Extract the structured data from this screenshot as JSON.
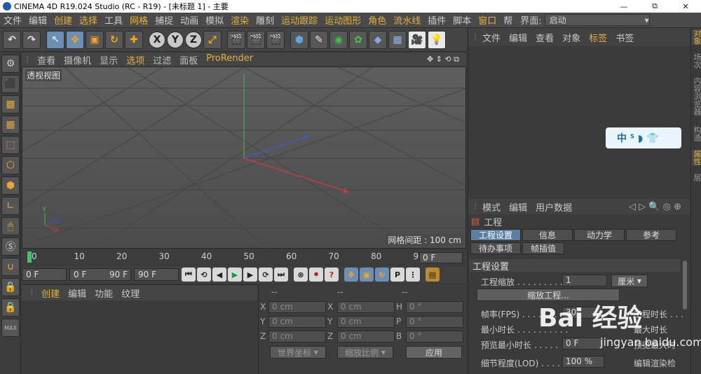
{
  "window": {
    "title": "CINEMA 4D R19.024 Studio (RC - R19) - [未标题 1] - 主要",
    "controls": [
      "—",
      "⧉",
      "✕"
    ]
  },
  "menu": {
    "items": [
      {
        "label": "文件",
        "accent": false
      },
      {
        "label": "编辑",
        "accent": false
      },
      {
        "label": "创建",
        "accent": true
      },
      {
        "label": "选择",
        "accent": true
      },
      {
        "label": "工具",
        "accent": false
      },
      {
        "label": "网格",
        "accent": true
      },
      {
        "label": "捕捉",
        "accent": false
      },
      {
        "label": "动画",
        "accent": false
      },
      {
        "label": "模拟",
        "accent": false
      },
      {
        "label": "渲染",
        "accent": true
      },
      {
        "label": "雕刻",
        "accent": false
      },
      {
        "label": "运动跟踪",
        "accent": true
      },
      {
        "label": "运动图形",
        "accent": true
      },
      {
        "label": "角色",
        "accent": true
      },
      {
        "label": "流水线",
        "accent": true
      },
      {
        "label": "插件",
        "accent": false
      },
      {
        "label": "脚本",
        "accent": false
      },
      {
        "label": "窗口",
        "accent": true
      },
      {
        "label": "帮",
        "accent": false
      }
    ],
    "layout_label": "界面:",
    "layout_value": "启动"
  },
  "toolbar": {
    "axis": [
      "X",
      "Y",
      "Z"
    ]
  },
  "viewport": {
    "menu": [
      {
        "label": "查看",
        "accent": false
      },
      {
        "label": "摄像机",
        "accent": false
      },
      {
        "label": "显示",
        "accent": false
      },
      {
        "label": "选项",
        "accent": true
      },
      {
        "label": "过滤",
        "accent": false
      },
      {
        "label": "面板",
        "accent": false
      },
      {
        "label": "ProRender",
        "accent": true
      }
    ],
    "label": "透视视图",
    "grid_distance": "网格间距 : 100 cm"
  },
  "timeline": {
    "ticks": [
      "0",
      "10",
      "20",
      "30",
      "40",
      "50",
      "60",
      "70",
      "80",
      "90"
    ],
    "frame": "0 F"
  },
  "playbar": {
    "start": "0 F",
    "min": "0 F",
    "max": "90 F",
    "end": "90 F"
  },
  "material": {
    "menu": [
      {
        "label": "创建",
        "accent": true
      },
      {
        "label": "编辑",
        "accent": false
      },
      {
        "label": "功能",
        "accent": false
      },
      {
        "label": "纹理",
        "accent": false
      }
    ]
  },
  "coords": {
    "headers": [
      "--",
      "--",
      "--"
    ],
    "rows": [
      {
        "a": "X",
        "av": "0 cm",
        "b": "X",
        "bv": "0 cm",
        "c": "H",
        "cv": "0 °"
      },
      {
        "a": "Y",
        "av": "0 cm",
        "b": "Y",
        "bv": "0 cm",
        "c": "P",
        "cv": "0 °"
      },
      {
        "a": "Z",
        "av": "0 cm",
        "b": "Z",
        "bv": "0 cm",
        "c": "B",
        "cv": "0 °"
      }
    ],
    "world": "世界坐标",
    "scale": "缩放比例",
    "apply": "应用"
  },
  "objects": {
    "menu": [
      {
        "label": "文件",
        "accent": false
      },
      {
        "label": "编辑",
        "accent": false
      },
      {
        "label": "查看",
        "accent": false
      },
      {
        "label": "对象",
        "accent": false
      },
      {
        "label": "标签",
        "accent": true
      },
      {
        "label": "书签",
        "accent": false
      }
    ]
  },
  "widget": {
    "text": "中 ⁵ ◗ 👕"
  },
  "attributes": {
    "menu": [
      "模式",
      "编辑",
      "用户数据"
    ],
    "title": "工程",
    "tabs": [
      {
        "label": "工程设置",
        "active": true
      },
      {
        "label": "信息",
        "active": false
      },
      {
        "label": "动力学",
        "active": false
      },
      {
        "label": "参考",
        "active": false
      },
      {
        "label": "待办事项",
        "active": false
      },
      {
        "label": "帧插值",
        "active": false
      }
    ],
    "section": "工程设置",
    "scale_label": "工程缩放 . . . . . . . . . . .",
    "scale_value": "1",
    "scale_unit": "厘米",
    "scale_button": "缩放工程...",
    "fps_label": "帧率(FPS) . . . . . . . . .",
    "fps_value": "30",
    "time_label": "工程时长 . . .",
    "min_label": "最小时长 . . . . . . . . . .",
    "max_label": "最大时长",
    "preview_min": "预览最小时长 . . . . .",
    "preview_min_value": "0 F",
    "preview_max": "预览最大时",
    "lod_label": "细节程度(LOD) . . . . .",
    "lod_value": "100 %",
    "render_lod": "编辑渲染检"
  },
  "right_strip": [
    {
      "label": "对象",
      "accent": true
    },
    {
      "label": "场次",
      "accent": false
    },
    {
      "label": "内容浏览器",
      "accent": false
    },
    {
      "label": "构造",
      "accent": false
    },
    {
      "label": "属性",
      "accent": true
    },
    {
      "label": "层",
      "accent": false
    }
  ],
  "watermark": {
    "brand": "Bai 经验",
    "url": "jingyan.baidu.com"
  },
  "colors": {
    "accent": "#e2b33c",
    "x_axis": "#c83c3c",
    "y_axis": "#3cbf3c",
    "z_axis": "#3c5cc8",
    "active_tab": "#5a7fa3"
  }
}
